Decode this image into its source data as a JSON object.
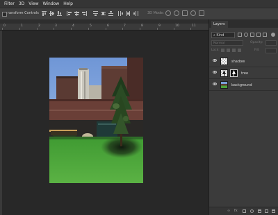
{
  "menu": [
    "Filter",
    "3D",
    "View",
    "Window",
    "Help"
  ],
  "options_bar": {
    "transform_label": "ransform Controls",
    "mode_label": "3D Mode:"
  },
  "ruler": [
    "0",
    "1",
    "2",
    "3",
    "4",
    "5",
    "6",
    "7",
    "8",
    "9",
    "10",
    "11"
  ],
  "layers_panel": {
    "tab_label": "Layers",
    "filter_kind": "Kind",
    "blend_mode": "Normal",
    "opacity_label": "Opacity:",
    "lock_label": "Lock:",
    "fill_label": "Fill:",
    "layers": [
      {
        "name": "shadow",
        "thumb": "transparent",
        "has_mask": false,
        "visible": true
      },
      {
        "name": "tree",
        "thumb": "transparent",
        "has_mask": true,
        "visible": true
      },
      {
        "name": "background",
        "thumb": "photo",
        "has_mask": false,
        "visible": true
      }
    ]
  },
  "colors": {
    "ui_background": "#282828",
    "panel_background": "#3b3b3b",
    "menubar": "#353535"
  }
}
